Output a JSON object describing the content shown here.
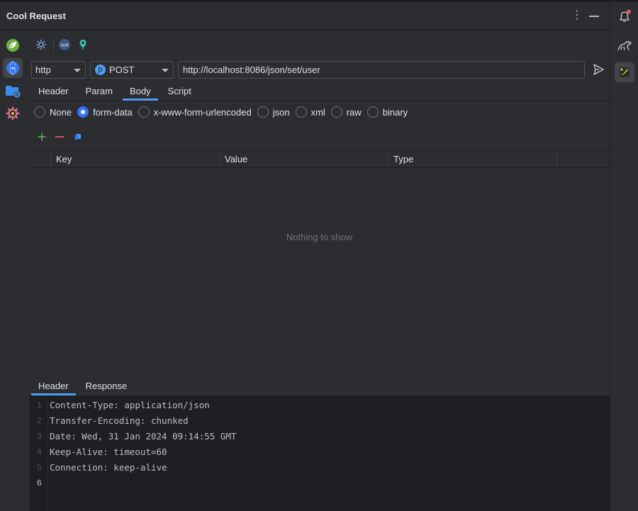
{
  "window": {
    "title": "Cool Request"
  },
  "request": {
    "protocol": "http",
    "method_badge": "p",
    "method": "POST",
    "url": "http://localhost:8086/json/set/user"
  },
  "request_tabs": [
    {
      "label": "Header"
    },
    {
      "label": "Param"
    },
    {
      "label": "Body"
    },
    {
      "label": "Script"
    }
  ],
  "body_types": [
    {
      "label": "None",
      "checked": false
    },
    {
      "label": "form-data",
      "checked": true
    },
    {
      "label": "x-www-form-urlencoded",
      "checked": false
    },
    {
      "label": "json",
      "checked": false
    },
    {
      "label": "xml",
      "checked": false
    },
    {
      "label": "raw",
      "checked": false
    },
    {
      "label": "binary",
      "checked": false
    }
  ],
  "table": {
    "columns": [
      "Key",
      "Value",
      "Type"
    ],
    "empty_text": "Nothing to show"
  },
  "response_tabs": [
    {
      "label": "Header"
    },
    {
      "label": "Response"
    }
  ],
  "response": {
    "line_numbers": [
      "1",
      "2",
      "3",
      "4",
      "5",
      "6"
    ],
    "lines": [
      "Content-Type: application/json",
      "Transfer-Encoding: chunked",
      "Date: Wed, 31 Jan 2024 09:14:55 GMT",
      "Keep-Alive: timeout=60",
      "Connection: keep-alive",
      ""
    ]
  },
  "icons": {
    "left_bar": [
      "spring-leaf-icon",
      "http-globe-icon",
      "folder-globe-icon",
      "settings-gear-icon"
    ],
    "right_bar": [
      "notifications-bell-icon",
      "dinosaur-icon",
      "cool-request-bee-icon"
    ],
    "toolbar": [
      "settings-cog-icon",
      "curl-import-icon",
      "location-pin-icon"
    ]
  },
  "colors": {
    "accent": "#3574f0",
    "tab_underline": "#4d9cf3",
    "add": "#5fb865",
    "remove": "#e55c5c",
    "notification_dot": "#e55765"
  }
}
